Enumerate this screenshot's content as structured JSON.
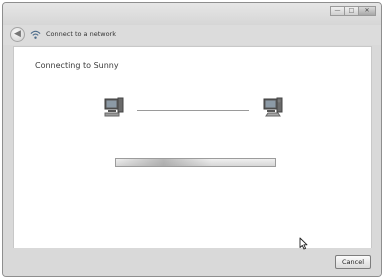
{
  "window": {
    "title": "Connect to a network",
    "caption_buttons": {
      "minimize": "—",
      "maximize": "□",
      "close": "✕"
    },
    "back_glyph": "◀"
  },
  "content": {
    "heading": "Connecting to Sunny",
    "icons": {
      "left": "computer-icon",
      "right": "network-computer-icon"
    }
  },
  "footer": {
    "cancel_label": "Cancel"
  },
  "colors": {
    "chrome": "#d9d9d9",
    "content_bg": "#ffffff",
    "border": "#8e8e8e"
  }
}
